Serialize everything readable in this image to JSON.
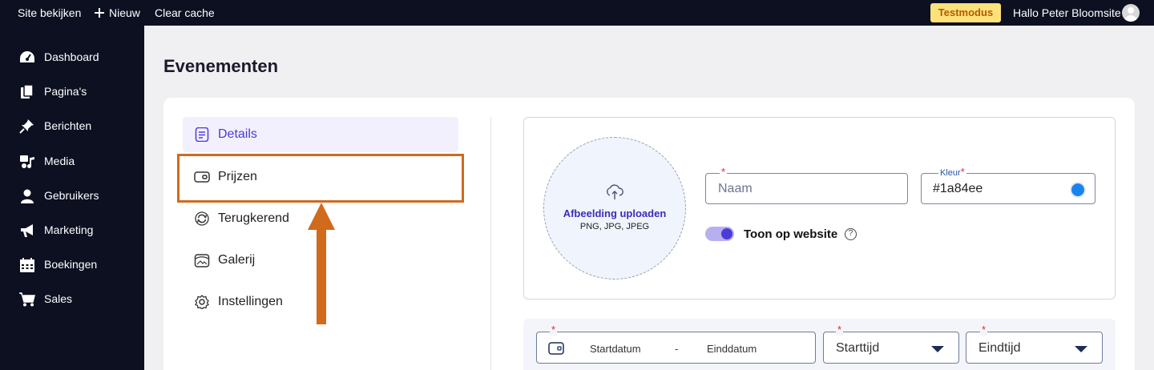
{
  "topbar": {
    "site_view": "Site bekijken",
    "new": "Nieuw",
    "clear_cache": "Clear cache",
    "test_mode": "Testmodus",
    "greeting": "Hallo Peter Bloomsite"
  },
  "sidebar": {
    "items": [
      {
        "label": "Dashboard",
        "icon": "dashboard-icon"
      },
      {
        "label": "Pagina's",
        "icon": "pages-icon"
      },
      {
        "label": "Berichten",
        "icon": "pin-icon"
      },
      {
        "label": "Media",
        "icon": "media-icon"
      },
      {
        "label": "Gebruikers",
        "icon": "user-icon"
      },
      {
        "label": "Marketing",
        "icon": "megaphone-icon"
      },
      {
        "label": "Boekingen",
        "icon": "calendar-icon"
      },
      {
        "label": "Sales",
        "icon": "cart-icon"
      }
    ]
  },
  "page": {
    "title": "Evenementen"
  },
  "subnav": {
    "items": [
      {
        "label": "Details",
        "icon": "document-icon",
        "active": true
      },
      {
        "label": "Prijzen",
        "icon": "wallet-icon",
        "active": false
      },
      {
        "label": "Terugkerend",
        "icon": "repeat-icon",
        "active": false
      },
      {
        "label": "Galerij",
        "icon": "gallery-icon",
        "active": false
      },
      {
        "label": "Instellingen",
        "icon": "settings-icon",
        "active": false
      }
    ]
  },
  "form": {
    "upload_title": "Afbeelding uploaden",
    "upload_formats": "PNG, JPG, JPEG",
    "name_placeholder": "Naam",
    "color_label": "Kleur",
    "color_value": "#1a84ee",
    "show_on_website": "Toon op website",
    "show_on_website_enabled": true,
    "help": "?",
    "required_mark": "*",
    "start_date_placeholder": "Startdatum",
    "date_separator": "-",
    "end_date_placeholder": "Einddatum",
    "start_time_placeholder": "Starttijd",
    "end_time_placeholder": "Eindtijd"
  },
  "colors": {
    "accent": "#4c3ad9",
    "highlight": "#d06a1d",
    "color_swatch": "#1a84ee",
    "sidebar_bg": "#0c1021",
    "test_badge": "#fde17a"
  }
}
